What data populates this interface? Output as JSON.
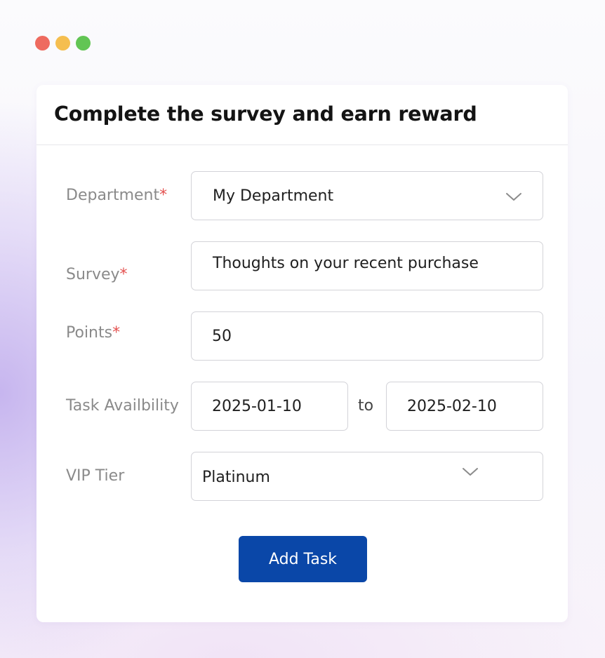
{
  "window": {
    "controls": [
      {
        "name": "close",
        "color": "#ee6a5f"
      },
      {
        "name": "minimize",
        "color": "#f5be4f"
      },
      {
        "name": "maximize",
        "color": "#62c554"
      }
    ]
  },
  "form": {
    "title": "Complete the survey and earn reward",
    "required_marker": "*",
    "department": {
      "label": "Department",
      "required": true,
      "value": "My Department",
      "icon": "chevron-down-icon"
    },
    "survey": {
      "label": "Survey",
      "required": true,
      "value": "Thoughts on your recent purchase"
    },
    "points": {
      "label": "Points",
      "required": true,
      "value": "50"
    },
    "availability": {
      "label": "Task Availbility",
      "start": "2025-01-10",
      "separator": "to",
      "end": "2025-02-10"
    },
    "vip_tier": {
      "label": "VIP Tier",
      "value": "Platinum",
      "icon": "chevron-down-icon"
    },
    "submit_label": "Add Task"
  },
  "colors": {
    "accent": "#0a47a8",
    "required": "#e45250",
    "label": "#8a8a8a"
  }
}
